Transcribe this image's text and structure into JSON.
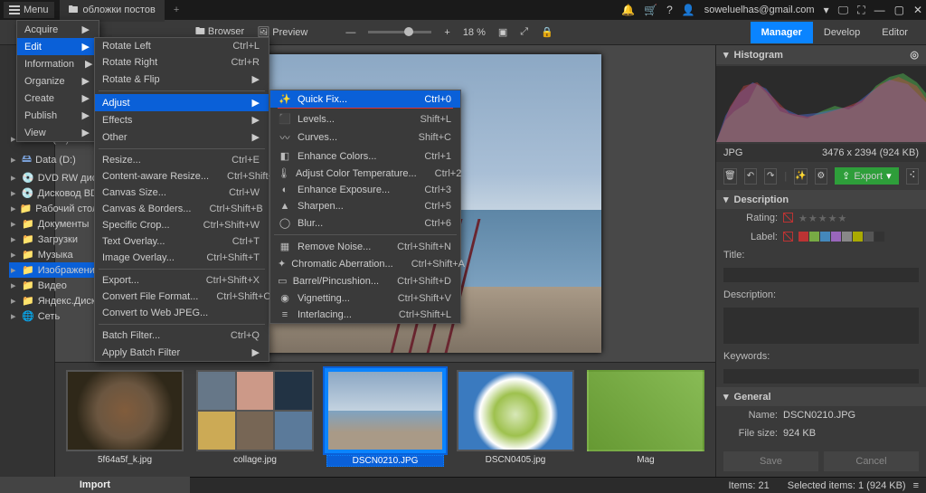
{
  "title": {
    "menu": "Menu",
    "tab": "обложки постов",
    "user": "soweluelhas@gmail.com"
  },
  "toolbar": {
    "browser": "Browser",
    "preview": "Preview",
    "zoom": "18 %"
  },
  "tabs": {
    "manager": "Manager",
    "develop": "Develop",
    "editor": "Editor"
  },
  "menu1": [
    {
      "label": "Acquire",
      "arrow": true
    },
    {
      "label": "Edit",
      "arrow": true,
      "hi": true
    },
    {
      "label": "Information",
      "arrow": true
    },
    {
      "label": "Organize",
      "arrow": true
    },
    {
      "label": "Create",
      "arrow": true
    },
    {
      "label": "Publish",
      "arrow": true
    },
    {
      "label": "View",
      "arrow": true
    }
  ],
  "menu2_rotate": [
    {
      "label": "Rotate Left",
      "sc": "Ctrl+L"
    },
    {
      "label": "Rotate Right",
      "sc": "Ctrl+R"
    },
    {
      "label": "Rotate & Flip",
      "arrow": true
    }
  ],
  "menu2_mid": [
    {
      "label": "Adjust",
      "arrow": true,
      "hi": true
    },
    {
      "label": "Effects",
      "arrow": true
    },
    {
      "label": "Other",
      "arrow": true
    }
  ],
  "menu2_rest": [
    {
      "label": "Resize...",
      "sc": "Ctrl+E"
    },
    {
      "label": "Content-aware Resize...",
      "sc": "Ctrl+Shift+E"
    },
    {
      "label": "Canvas Size...",
      "sc": "Ctrl+W"
    },
    {
      "label": "Canvas & Borders...",
      "sc": "Ctrl+Shift+B"
    },
    {
      "label": "Specific Crop...",
      "sc": "Ctrl+Shift+W"
    },
    {
      "label": "Text Overlay...",
      "sc": "Ctrl+T"
    },
    {
      "label": "Image Overlay...",
      "sc": "Ctrl+Shift+T"
    }
  ],
  "menu2_export": [
    {
      "label": "Export...",
      "sc": "Ctrl+Shift+X"
    },
    {
      "label": "Convert File Format...",
      "sc": "Ctrl+Shift+O"
    },
    {
      "label": "Convert to Web JPEG..."
    }
  ],
  "menu2_batch": [
    {
      "label": "Batch Filter...",
      "sc": "Ctrl+Q"
    },
    {
      "label": "Apply Batch Filter",
      "arrow": true
    }
  ],
  "menu3_a": [
    {
      "ico": "✨",
      "label": "Quick Fix...",
      "sc": "Ctrl+0",
      "hi": true
    },
    {
      "ico": "⬛",
      "label": "Levels...",
      "sc": "Shift+L"
    },
    {
      "ico": "〰",
      "label": "Curves...",
      "sc": "Shift+C"
    },
    {
      "ico": "◧",
      "label": "Enhance Colors...",
      "sc": "Ctrl+1"
    },
    {
      "ico": "🌡",
      "label": "Adjust Color Temperature...",
      "sc": "Ctrl+2"
    },
    {
      "ico": "◐",
      "label": "Enhance Exposure...",
      "sc": "Ctrl+3"
    },
    {
      "ico": "▲",
      "label": "Sharpen...",
      "sc": "Ctrl+5"
    },
    {
      "ico": "◯",
      "label": "Blur...",
      "sc": "Ctrl+6"
    }
  ],
  "menu3_b": [
    {
      "ico": "▦",
      "label": "Remove Noise...",
      "sc": "Ctrl+Shift+N"
    },
    {
      "ico": "✦",
      "label": "Chromatic Aberration...",
      "sc": "Ctrl+Shift+A"
    },
    {
      "ico": "▭",
      "label": "Barrel/Pincushion...",
      "sc": "Ctrl+Shift+D"
    },
    {
      "ico": "◉",
      "label": "Vignetting...",
      "sc": "Ctrl+Shift+V"
    },
    {
      "ico": "≡",
      "label": "Interlacing...",
      "sc": "Ctrl+Shift+L"
    }
  ],
  "tree": [
    {
      "label": "OS (C:)",
      "ico": "🖴"
    },
    {
      "label": "Data (D:)",
      "ico": "🖴"
    },
    {
      "label": "DVD RW дис",
      "ico": "💿"
    },
    {
      "label": "Дисковод BD",
      "ico": "💿"
    },
    {
      "label": "Рабочий стол",
      "ico": "📁"
    },
    {
      "label": "Документы",
      "ico": "📁"
    },
    {
      "label": "Загрузки",
      "ico": "📁"
    },
    {
      "label": "Музыка",
      "ico": "📁"
    },
    {
      "label": "Изображени",
      "ico": "📁",
      "sel": true
    },
    {
      "label": "Видео",
      "ico": "📁"
    },
    {
      "label": "Яндекс.Диск",
      "ico": "📁"
    },
    {
      "label": "Сеть",
      "ico": "🌐",
      "bold": true
    }
  ],
  "thumbs": [
    {
      "name": "5f64a5f_k.jpg"
    },
    {
      "name": "collage.jpg"
    },
    {
      "name": "DSCN0210.JPG",
      "sel": true
    },
    {
      "name": "DSCN0405.jpg"
    },
    {
      "name": "Mag"
    }
  ],
  "right": {
    "histogram": "Histogram",
    "ext": "JPG",
    "dims": "3476 x 2394 (924 KB)",
    "export": "Export",
    "description": "Description",
    "rating": "Rating:",
    "label": "Label:",
    "title_lab": "Title:",
    "desc_lab": "Description:",
    "keywords": "Keywords:",
    "general": "General",
    "name_lab": "Name:",
    "name_val": "DSCN0210.JPG",
    "size_lab": "File size:",
    "size_val": "924 KB",
    "save": "Save",
    "cancel": "Cancel"
  },
  "status": {
    "items": "Items: 21",
    "selected": "Selected items: 1 (924 KB)"
  },
  "import": "Import",
  "label_colors": [
    "#b33",
    "#7a4",
    "#48b",
    "#96b",
    "#888",
    "#aa0",
    "#555",
    "#333"
  ]
}
